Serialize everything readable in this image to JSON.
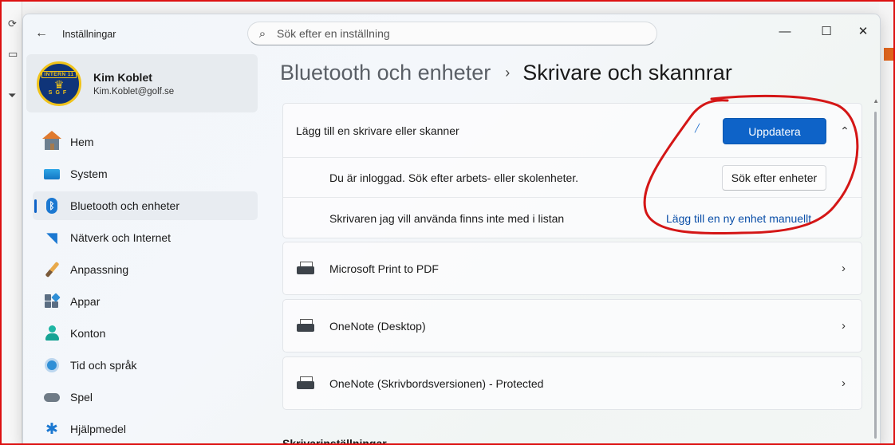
{
  "window": {
    "title": "Inställningar",
    "search_placeholder": "Sök efter en inställning"
  },
  "profile": {
    "name": "Kim Koblet",
    "email": "Kim.Koblet@golf.se",
    "avatar_text": "INTERN 11",
    "avatar_letters": "SGF"
  },
  "nav": [
    {
      "label": "Hem",
      "icon": "home-icon"
    },
    {
      "label": "System",
      "icon": "system-icon"
    },
    {
      "label": "Bluetooth och enheter",
      "icon": "bluetooth-icon",
      "active": true
    },
    {
      "label": "Nätverk och Internet",
      "icon": "wifi-icon"
    },
    {
      "label": "Anpassning",
      "icon": "brush-icon"
    },
    {
      "label": "Appar",
      "icon": "apps-icon"
    },
    {
      "label": "Konton",
      "icon": "account-icon"
    },
    {
      "label": "Tid och språk",
      "icon": "time-language-icon"
    },
    {
      "label": "Spel",
      "icon": "gaming-icon"
    },
    {
      "label": "Hjälpmedel",
      "icon": "accessibility-icon"
    }
  ],
  "breadcrumb": {
    "parent": "Bluetooth och enheter",
    "separator": "›",
    "current": "Skrivare och skannrar"
  },
  "add_device": {
    "title": "Lägg till en skrivare eller skanner",
    "refresh_label": "Uppdatera",
    "signed_in_text": "Du är inloggad. Sök efter arbets- eller skolenheter.",
    "search_devices_label": "Sök efter enheter",
    "not_listed_text": "Skrivaren jag vill använda finns inte med i listan",
    "add_manually_label": "Lägg till en ny enhet manuellt"
  },
  "printers": [
    {
      "name": "Microsoft Print to PDF"
    },
    {
      "name": "OneNote (Desktop)"
    },
    {
      "name": "OneNote (Skrivbordsversionen) - Protected"
    }
  ],
  "section_heading": "Skrivarinställningar",
  "colors": {
    "accent": "#0e63c8",
    "annotation": "#d41616"
  }
}
